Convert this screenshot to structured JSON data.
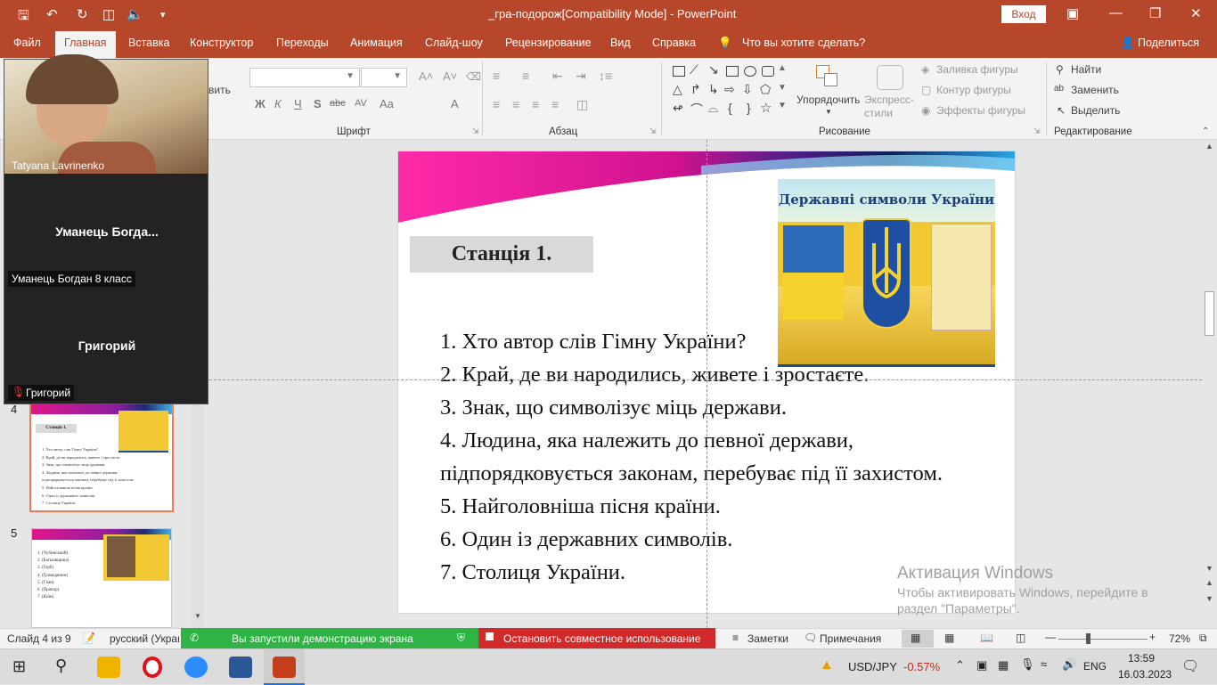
{
  "titlebar": {
    "title": "_гра-подорож[Compatibility Mode]  -  PowerPoint",
    "sign_in": "Вход"
  },
  "menu": {
    "tabs": [
      "Файл",
      "Главная",
      "Вставка",
      "Конструктор",
      "Переходы",
      "Анимация",
      "Слайд-шоу",
      "Рецензирование",
      "Вид",
      "Справка"
    ],
    "tell_me": "Что вы хотите сделать?",
    "share": "Поделиться"
  },
  "ribbon": {
    "clipboard_partial": "вить",
    "font_group": "Шрифт",
    "paragraph_group": "Абзац",
    "drawing_group": "Рисование",
    "editing_group": "Редактирование",
    "arrange": "Упорядочить",
    "quick_styles": "Экспресс-\nстили",
    "shape_fill": "Заливка фигуры",
    "shape_outline": "Контур фигуры",
    "shape_effects": "Эффекты фигуры",
    "find": "Найти",
    "replace": "Заменить",
    "select": "Выделить",
    "bold": "Ж",
    "italic": "К",
    "underline": "Ч",
    "shadow": "S",
    "strike": "abc",
    "spacing": "AV",
    "case": "Aa",
    "font_color": "A"
  },
  "slide": {
    "station": "Станція 1.",
    "questions": [
      "1. Хто автор слів Гімну України?",
      "2. Край, де ви народились, живете і зростаєте.",
      "3. Знак, що символізує міць держави.",
      "4. Людина, яка належить до певної держави,",
      "підпорядковується законам, перебуває під її захистом.",
      "5.  Найголовніша пісня країни.",
      "6. Один із державних символів.",
      "7. Столиця України."
    ],
    "image_title": "Державні символи України"
  },
  "thumbnails": {
    "slide4_number": "4",
    "slide5_number": "5",
    "slide4_title": "Станція 1.",
    "slide5_items": [
      "1.  (Чубинський)",
      "2.  (Батьківщина)",
      "3.  (Герб)",
      "4.  (Громадянин)",
      "5.  (Гімн)",
      "6.  (Прапор)",
      "7.  (Київ)"
    ]
  },
  "video": {
    "participant1": "Tatyana Lavrinenko",
    "participant2_center": "Уманець  Богда...",
    "participant2": "Уманець Богдан 8 класс",
    "participant3_center": "Григорий",
    "participant3": "Григорий"
  },
  "statusbar": {
    "slide_info": "Слайд 4 из 9",
    "language": "русский (Украи",
    "sharing": "Вы запустили демонстрацию экрана",
    "stop_sharing": "Остановить совместное использование",
    "notes": "Заметки",
    "comments": "Примечания",
    "zoom": "72%"
  },
  "activation": {
    "title": "Активация Windows",
    "line1": "Чтобы активировать Windows, перейдите в",
    "line2": "раздел \"Параметры\"."
  },
  "taskbar": {
    "ticker": "USD/JPY",
    "change": "-0.57%",
    "lang": "ENG",
    "time": "13:59",
    "date": "16.03.2023"
  }
}
